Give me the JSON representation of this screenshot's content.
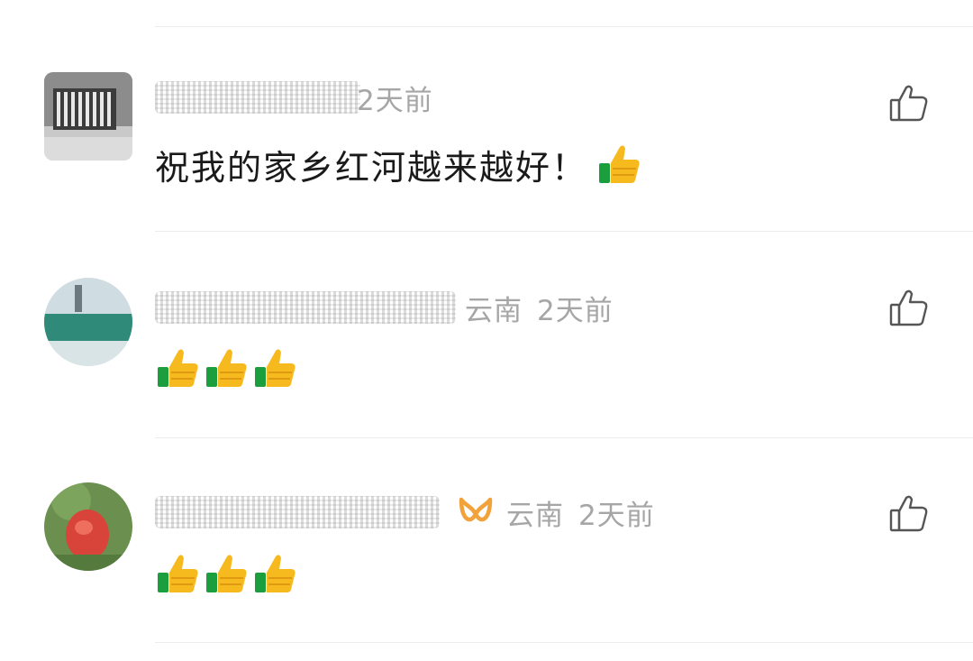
{
  "comments": [
    {
      "meta": "2天前",
      "location": "",
      "text": "祝我的家乡红河越来越好！",
      "emoji_name": "thumbs-up-emoji",
      "emoji_count": 1
    },
    {
      "meta": "2天前",
      "location": "云南",
      "text": "",
      "emoji_name": "thumbs-up-emoji",
      "emoji_count": 3
    },
    {
      "meta": "2天前",
      "location": "云南",
      "text": "",
      "emoji_name": "thumbs-up-emoji",
      "emoji_count": 3
    }
  ],
  "icons": {
    "like": "thumbs-up-outline-icon",
    "badge": "orange-ribbon-badge-icon"
  },
  "colors": {
    "meta_text": "#a6a6a6",
    "content_text": "#1a1a1a",
    "badge_orange": "#f2a23a",
    "thumb_yellow": "#f6b91e",
    "thumb_green": "#1b9e3e",
    "divider": "#ececec"
  }
}
